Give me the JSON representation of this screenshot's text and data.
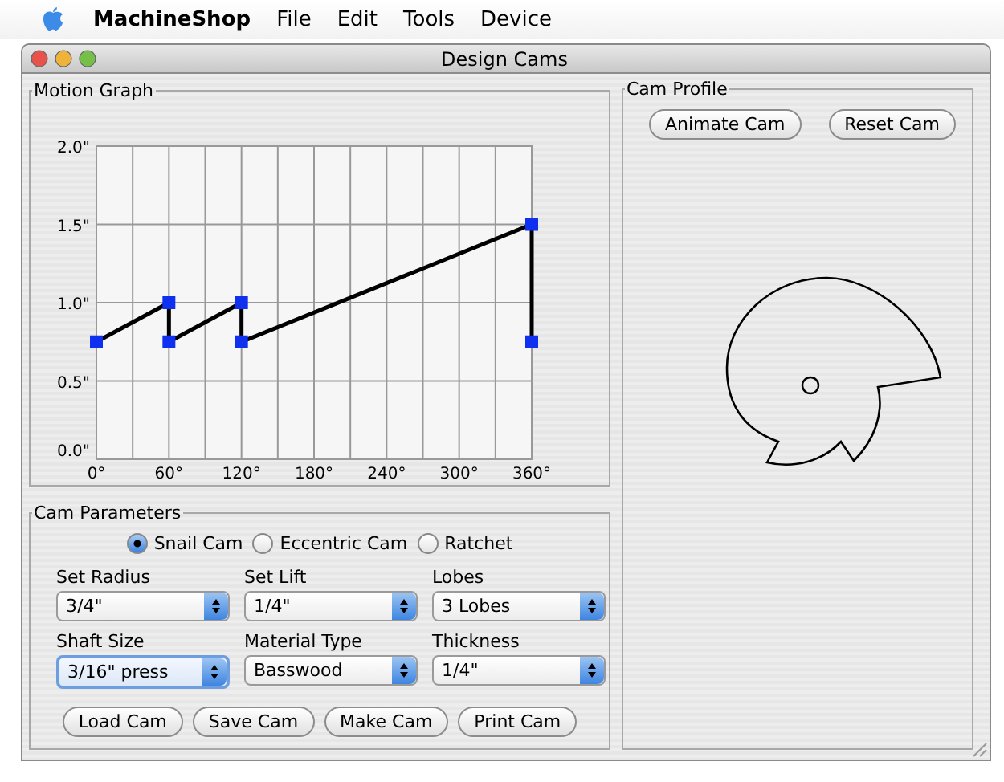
{
  "menu_bar": {
    "app_name": "MachineShop",
    "items": [
      "File",
      "Edit",
      "Tools",
      "Device"
    ]
  },
  "window": {
    "title": "Design Cams"
  },
  "motion_graph": {
    "title": "Motion Graph",
    "chart_data": {
      "type": "line",
      "x": [
        0,
        60,
        60,
        120,
        120,
        360,
        360
      ],
      "values": [
        0.75,
        1.0,
        0.75,
        1.0,
        0.75,
        1.5,
        0.75
      ],
      "xlim": [
        0,
        360
      ],
      "ylim": [
        0,
        2
      ],
      "grid": true,
      "marker": true,
      "xticks": [
        {
          "value": 0,
          "label": "0°"
        },
        {
          "value": 60,
          "label": "60°"
        },
        {
          "value": 120,
          "label": "120°"
        },
        {
          "value": 180,
          "label": "180°"
        },
        {
          "value": 240,
          "label": "240°"
        },
        {
          "value": 300,
          "label": "300°"
        },
        {
          "value": 360,
          "label": "360°"
        }
      ],
      "yticks": [
        {
          "value": 0,
          "label": "0.0\""
        },
        {
          "value": 0.5,
          "label": "0.5\""
        },
        {
          "value": 1,
          "label": "1.0\""
        },
        {
          "value": 1.5,
          "label": "1.5\""
        },
        {
          "value": 2,
          "label": "2.0\""
        }
      ]
    }
  },
  "cam_parameters": {
    "title": "Cam Parameters",
    "cam_types": [
      {
        "label": "Snail Cam",
        "selected": true
      },
      {
        "label": "Eccentric Cam",
        "selected": false
      },
      {
        "label": "Ratchet",
        "selected": false
      }
    ],
    "fields": [
      {
        "label": "Set Radius",
        "value": "3/4\"",
        "focused": false
      },
      {
        "label": "Set Lift",
        "value": "1/4\"",
        "focused": false
      },
      {
        "label": "Lobes",
        "value": "3 Lobes",
        "focused": false
      },
      {
        "label": "Shaft Size",
        "value": "3/16\" press",
        "focused": true
      },
      {
        "label": "Material Type",
        "value": "Basswood",
        "focused": false
      },
      {
        "label": "Thickness",
        "value": "1/4\"",
        "focused": false
      }
    ],
    "buttons": [
      "Load Cam",
      "Save Cam",
      "Make Cam",
      "Print Cam"
    ]
  },
  "cam_profile": {
    "title": "Cam Profile",
    "buttons": [
      "Animate Cam",
      "Reset Cam"
    ]
  }
}
